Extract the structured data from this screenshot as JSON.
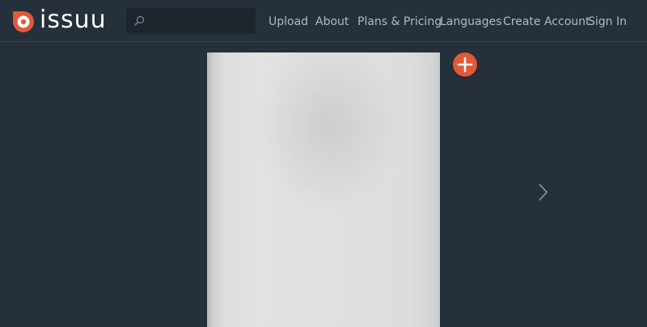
{
  "header": {
    "brand": "issuu",
    "search": {
      "value": "",
      "placeholder": ""
    },
    "nav": [
      {
        "label": "Upload"
      },
      {
        "label": "About"
      },
      {
        "label": "Plans & Pricing"
      },
      {
        "label": "Languages"
      },
      {
        "label": "Create Account"
      },
      {
        "label": "Sign In"
      }
    ]
  },
  "viewer": {
    "add_icon": "plus-icon",
    "next_icon": "chevron-right-icon"
  },
  "colors": {
    "background": "#26303a",
    "brand_accent": "#e05a3a",
    "nav_text": "#a9bccb",
    "search_bg": "#1d252d"
  }
}
